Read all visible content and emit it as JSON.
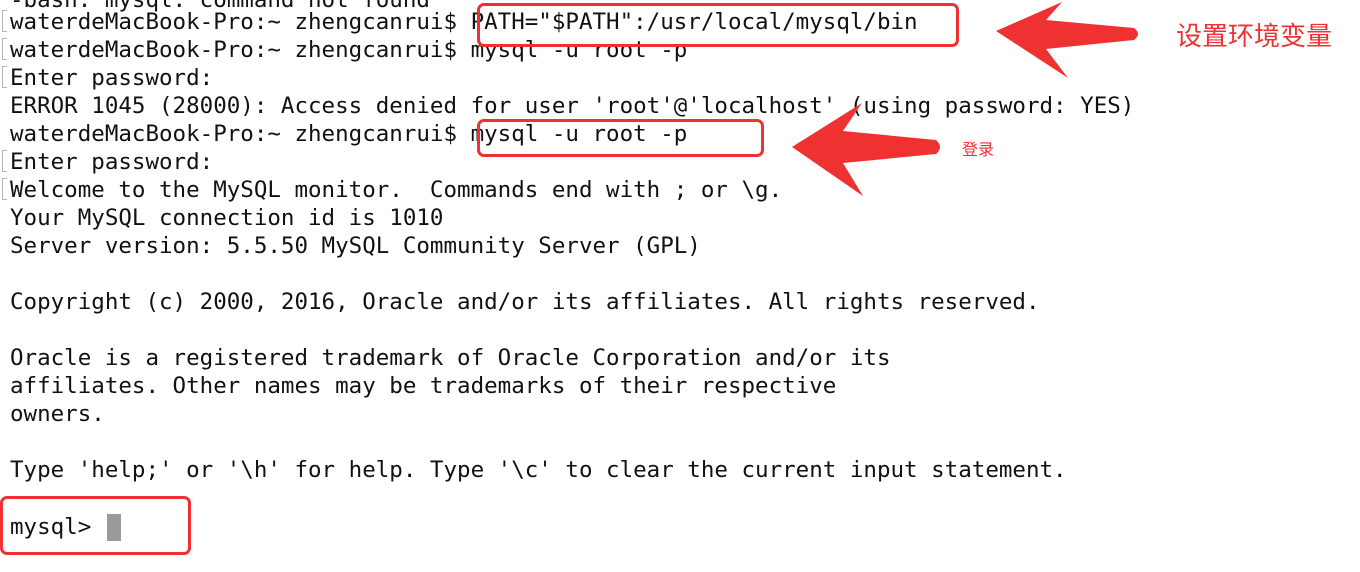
{
  "terminal": {
    "clipped_line": "-bash: mysql: command not found",
    "lines": [
      "waterdeMacBook-Pro:~ zhengcanrui$ PATH=\"$PATH\":/usr/local/mysql/bin",
      "waterdeMacBook-Pro:~ zhengcanrui$ mysql -u root -p",
      "Enter password:",
      "ERROR 1045 (28000): Access denied for user 'root'@'localhost' (using password: YES)",
      "waterdeMacBook-Pro:~ zhengcanrui$ mysql -u root -p",
      "Enter password:",
      "Welcome to the MySQL monitor.  Commands end with ; or \\g.",
      "Your MySQL connection id is 1010",
      "Server version: 5.5.50 MySQL Community Server (GPL)",
      "",
      "Copyright (c) 2000, 2016, Oracle and/or its affiliates. All rights reserved.",
      "",
      "Oracle is a registered trademark of Oracle Corporation and/or its",
      "affiliates. Other names may be trademarks of their respective",
      "owners.",
      "",
      "Type 'help;' or '\\h' for help. Type '\\c' to clear the current input statement.",
      ""
    ],
    "prompt": "mysql>"
  },
  "annotations": {
    "set_env_label": "设置环境变量",
    "login_label": "登录",
    "color": "#ef3131"
  }
}
